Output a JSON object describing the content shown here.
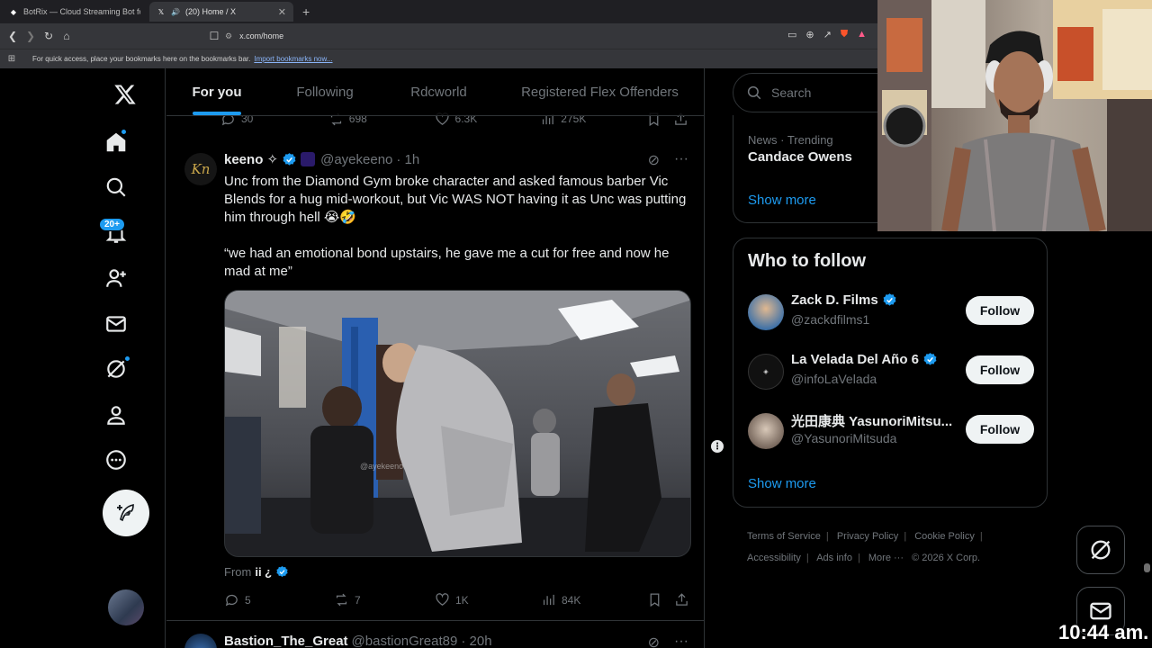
{
  "browser": {
    "tabs": [
      {
        "title": "BotRix — Cloud Streaming Bot for Tw"
      },
      {
        "title": "(20) Home / X"
      }
    ],
    "url": "x.com/home",
    "bookmark_hint": "For quick access, place your bookmarks here on the bookmarks bar.",
    "bookmark_import": "Import bookmarks now..."
  },
  "nav": {
    "notifications_badge": "20+"
  },
  "timeline": {
    "tabs": [
      "For you",
      "Following",
      "Rdcworld",
      "Registered Flex Offenders"
    ],
    "prev_tweet_actions": {
      "replies": "30",
      "reposts": "698",
      "likes": "6.3K",
      "views": "275K"
    },
    "tweet": {
      "name": "keeno ✧",
      "handle": "@ayekeeno",
      "time": "· 1h",
      "text_p1": "Unc from the Diamond Gym broke character and asked famous barber Vic Blends for a hug mid-workout, but Vic WAS NOT having it as Unc was putting him through hell 😭🤣",
      "text_p2": "“we had an emotional bond upstairs, he gave me a cut for free and now he mad at me”",
      "media_watermark": "@ayekeeno",
      "from_label": "From",
      "from_name": "ii ¿",
      "replies": "5",
      "reposts": "7",
      "likes": "1K",
      "views": "84K"
    },
    "next_tweet": {
      "name": "Bastion_The_Great",
      "handle": "@bastionGreat89",
      "time": "· 20h"
    }
  },
  "sidebar": {
    "search_placeholder": "Search",
    "trend_meta": "News · Trending",
    "trend_name": "Candace Owens",
    "show_more": "Show more",
    "who_to_follow_title": "Who to follow",
    "follow_label": "Follow",
    "suggestions": [
      {
        "name": "Zack D. Films",
        "handle": "@zackdfilms1",
        "verified": true
      },
      {
        "name": "La Velada Del Año 6",
        "handle": "@infoLaVelada",
        "verified": true
      },
      {
        "name": "光田康典 YasunoriMitsu...",
        "handle": "@YasunoriMitsuda",
        "verified": false
      }
    ],
    "footer": [
      "Terms of Service",
      "Privacy Policy",
      "Cookie Policy",
      "Accessibility",
      "Ads info",
      "More ···",
      "© 2026 X Corp."
    ]
  },
  "overlay": {
    "clock": "10:44 am."
  },
  "colors": {
    "accent": "#1d9bf0",
    "background": "#000000",
    "text": "#e7e9ea",
    "muted": "#71767b",
    "border": "#2f3336"
  }
}
